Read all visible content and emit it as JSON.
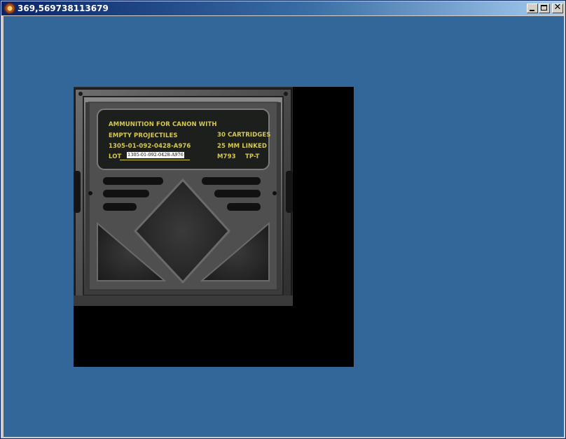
{
  "window": {
    "title": "369,569738113679",
    "buttons": {
      "minimize": "minimize",
      "maximize": "maximize",
      "close": "✕"
    }
  },
  "colors": {
    "client_background": "#336699",
    "titlebar_start": "#0a246a",
    "titlebar_end": "#a6caf0",
    "label_text": "#d8c94a"
  },
  "crate_label": {
    "line1": "AMMUNITION FOR CANON WITH",
    "line2": "EMPTY PROJECTILES",
    "line3": "1305-01-092-0428-A976",
    "lot_label": "LOT",
    "lot_value": "1305-01-092-0428-A976",
    "cartridges": "30 CARTRIDGES",
    "caliber": "25 MM  LINKED",
    "model": "M793",
    "type": "TP-T"
  }
}
